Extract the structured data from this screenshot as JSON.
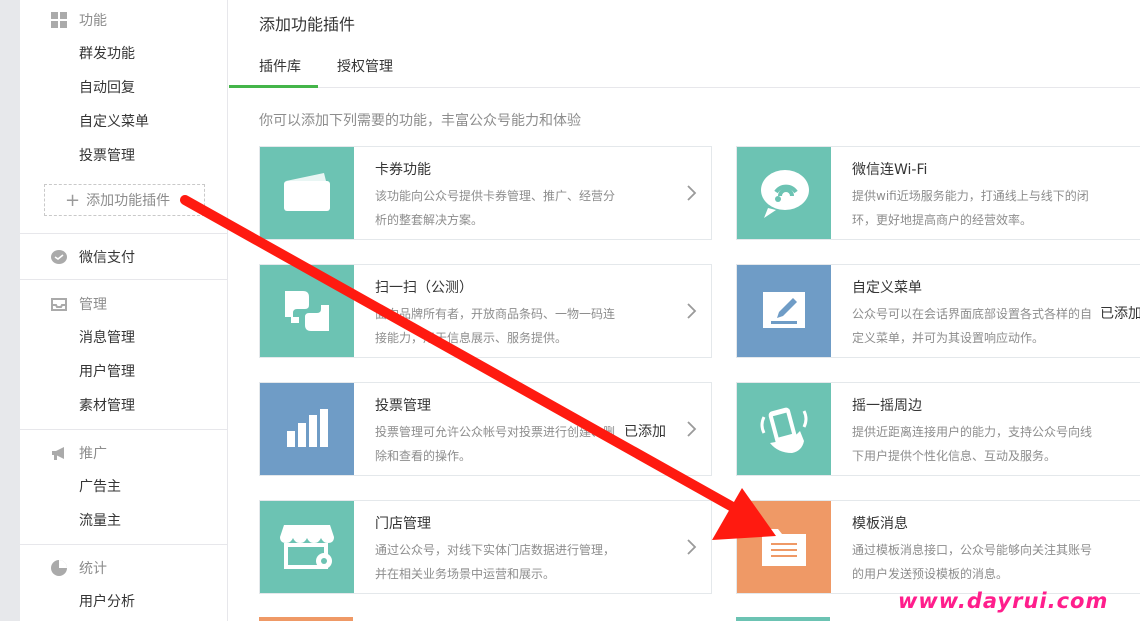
{
  "sidebar": {
    "sections": [
      {
        "title": "功能",
        "icon": "grid-icon",
        "items": [
          "群发功能",
          "自动回复",
          "自定义菜单",
          "投票管理"
        ]
      },
      {
        "title": "微信支付",
        "icon": "wallet-icon",
        "items": []
      },
      {
        "title": "管理",
        "icon": "inbox-icon",
        "items": [
          "消息管理",
          "用户管理",
          "素材管理"
        ]
      },
      {
        "title": "推广",
        "icon": "megaphone-icon",
        "items": [
          "广告主",
          "流量主"
        ]
      },
      {
        "title": "统计",
        "icon": "pie-chart-icon",
        "items": [
          "用户分析"
        ]
      }
    ],
    "add_plugin_label": "添加功能插件",
    "add_plugin_icon": "plus-icon"
  },
  "main": {
    "title": "添加功能插件",
    "tabs": [
      "插件库",
      "授权管理"
    ],
    "active_tab": "插件库",
    "intro": "你可以添加下列需要的功能，丰富公众号能力和体验",
    "cards": [
      {
        "title": "卡券功能",
        "desc": "该功能向公众号提供卡券管理、推广、经营分析的整套解决方案。",
        "added": "",
        "color": "#6cc3b3",
        "icon": "card-icon"
      },
      {
        "title": "微信连Wi-Fi",
        "desc": "提供wifi近场服务能力，打通线上与线下的闭环，更好地提高商户的经营效率。",
        "added": "",
        "color": "#6cc3b3",
        "icon": "wifi-icon"
      },
      {
        "title": "扫一扫（公测）",
        "desc": "面向品牌所有者，开放商品条码、一物一码连接能力，用于信息展示、服务提供。",
        "added": "",
        "color": "#6cc3b3",
        "icon": "scan-icon"
      },
      {
        "title": "自定义菜单",
        "desc": "公众号可以在会话界面底部设置各式各样的自定义菜单，并可为其设置响应动作。",
        "added": "已添加",
        "color": "#6f9cc6",
        "icon": "edit-icon"
      },
      {
        "title": "投票管理",
        "desc": "投票管理可允许公众帐号对投票进行创建、删除和查看的操作。",
        "added": "已添加",
        "color": "#6f9cc6",
        "icon": "bar-chart-icon"
      },
      {
        "title": "摇一摇周边",
        "desc": "提供近距离连接用户的能力，支持公众号向线下用户提供个性化信息、互动及服务。",
        "added": "",
        "color": "#6cc3b3",
        "icon": "shake-phone-icon"
      },
      {
        "title": "门店管理",
        "desc": "通过公众号，对线下实体门店数据进行管理，并在相关业务场景中运营和展示。",
        "added": "",
        "color": "#6cc3b3",
        "icon": "store-icon"
      },
      {
        "title": "模板消息",
        "desc": "通过模板消息接口，公众号能够向关注其账号的用户发送预设模板的消息。",
        "added": "",
        "color": "#ef9966",
        "icon": "document-icon"
      }
    ]
  },
  "annotation": {
    "arrow_color": "#ff1a10",
    "icon": "red-arrow-icon"
  },
  "watermark": "www.dayrui.com"
}
